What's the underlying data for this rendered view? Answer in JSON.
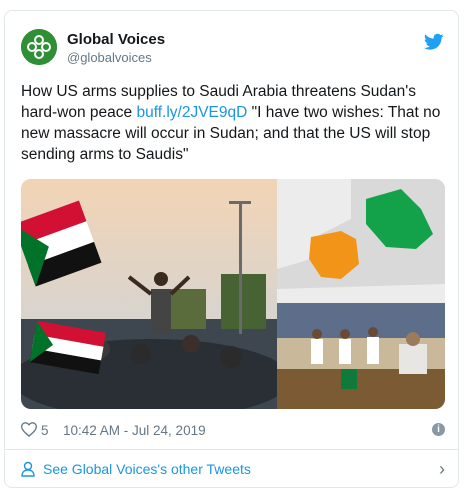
{
  "tweet": {
    "author_name": "Global Voices",
    "author_handle": "@globalvoices",
    "text_before_link": "How US arms supplies to Saudi Arabia threatens Sudan's hard-won peace ",
    "link_text": "buff.ly/2JVE9qD",
    "text_after_link": " \"I have two wishes: That no new massacre will occur in Sudan; and that the US will stop sending arms to Saudis\"",
    "likes": "5",
    "timestamp": "10:42 AM - Jul 24, 2019",
    "footer_label": "See Global Voices's other Tweets"
  },
  "icons": {
    "avatar": "global-voices-logo",
    "brand": "twitter-bird-icon",
    "like": "heart-icon",
    "info": "info-icon",
    "person": "person-icon",
    "chevron": "chevron-right-icon"
  },
  "colors": {
    "link": "#1b95e0",
    "muted": "#657786",
    "border": "#e1e8ed",
    "brand_green": "#2f8f35"
  }
}
